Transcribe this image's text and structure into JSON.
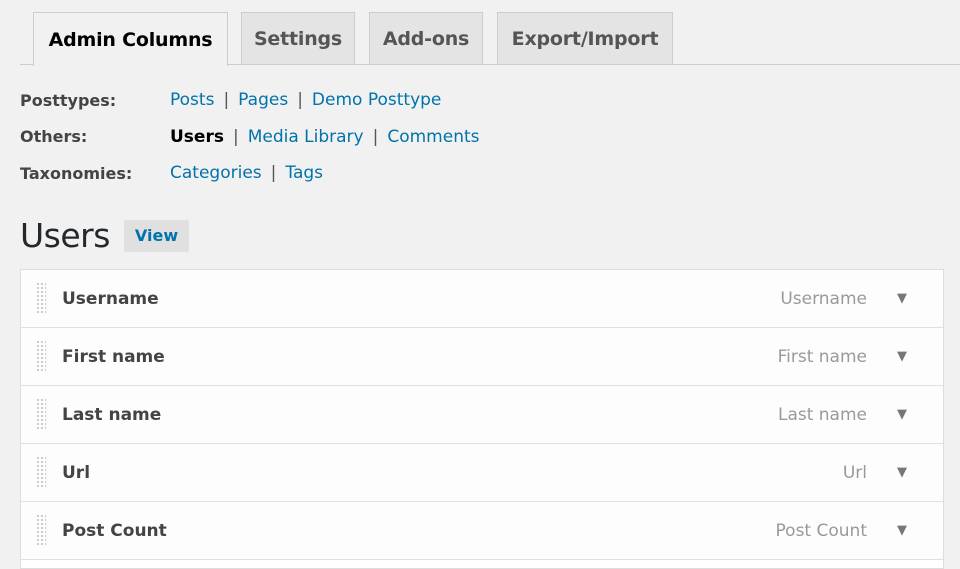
{
  "tabs": [
    {
      "label": "Admin Columns",
      "active": true
    },
    {
      "label": "Settings",
      "active": false
    },
    {
      "label": "Add-ons",
      "active": false
    },
    {
      "label": "Export/Import",
      "active": false
    }
  ],
  "subnav": {
    "posttypes": {
      "label": "Posttypes:",
      "links": [
        "Posts",
        "Pages",
        "Demo Posttype"
      ]
    },
    "others": {
      "label": "Others:",
      "links": [
        "Users",
        "Media Library",
        "Comments"
      ],
      "current": "Users"
    },
    "taxonomies": {
      "label": "Taxonomies:",
      "links": [
        "Categories",
        "Tags"
      ]
    },
    "separator": "|"
  },
  "heading": {
    "title": "Users",
    "view_label": "View"
  },
  "columns": [
    {
      "name": "Username",
      "type": "Username"
    },
    {
      "name": "First name",
      "type": "First name"
    },
    {
      "name": "Last name",
      "type": "Last name"
    },
    {
      "name": "Url",
      "type": "Url"
    },
    {
      "name": "Post Count",
      "type": "Post Count"
    }
  ],
  "icons": {
    "toggle": "▼",
    "drag": "drag-handle-icon"
  },
  "colors": {
    "link": "#0073aa",
    "background": "#f1f1f1",
    "panel": "#ffffff"
  }
}
